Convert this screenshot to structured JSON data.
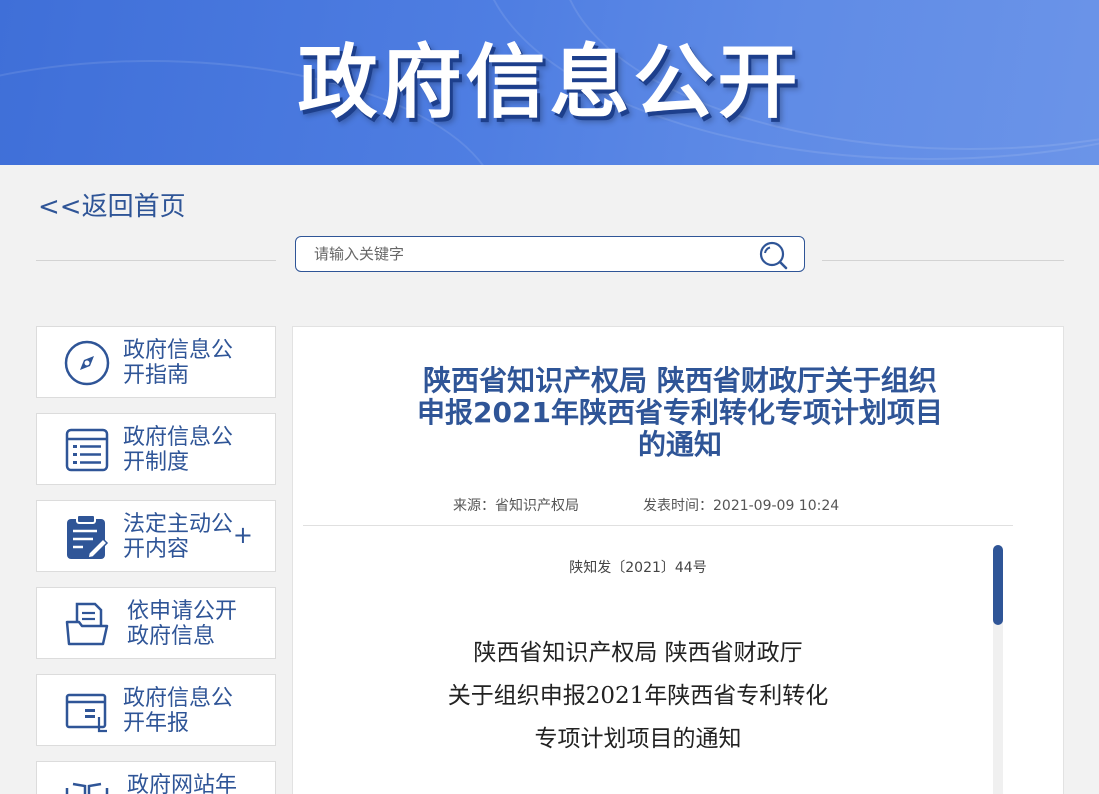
{
  "banner": {
    "title": "政府信息公开"
  },
  "nav": {
    "back_label": "<<返回首页"
  },
  "search": {
    "placeholder": "请输入关键字",
    "icon": "search-icon"
  },
  "sidebar": {
    "items": [
      {
        "label": "政府信息公开指南",
        "icon": "compass-icon"
      },
      {
        "label": "政府信息公开制度",
        "icon": "document-list-icon"
      },
      {
        "label": "法定主动公开内容",
        "icon": "clipboard-edit-icon",
        "expand": "+"
      },
      {
        "label": "依申请公开政府信息",
        "icon": "folder-document-icon"
      },
      {
        "label": "政府信息公开年报",
        "icon": "report-icon"
      },
      {
        "label": "政府网站年",
        "icon": "book-icon"
      }
    ]
  },
  "article": {
    "title": "陕西省知识产权局 陕西省财政厅关于组织申报2021年陕西省专利转化专项计划项目的通知",
    "source": "来源：省知识产权局",
    "publish_time": "发表时间：2021-09-09 10:24",
    "doc_number": "陕知发〔2021〕44号",
    "body_title_lines": [
      "陕西省知识产权局  陕西省财政厅",
      "关于组织申报2021年陕西省专利转化",
      "专项计划项目的通知"
    ]
  },
  "colors": {
    "brand_blue": "#2f5597",
    "banner_blue": "#4f7ee2",
    "background": "#f2f2f2"
  }
}
